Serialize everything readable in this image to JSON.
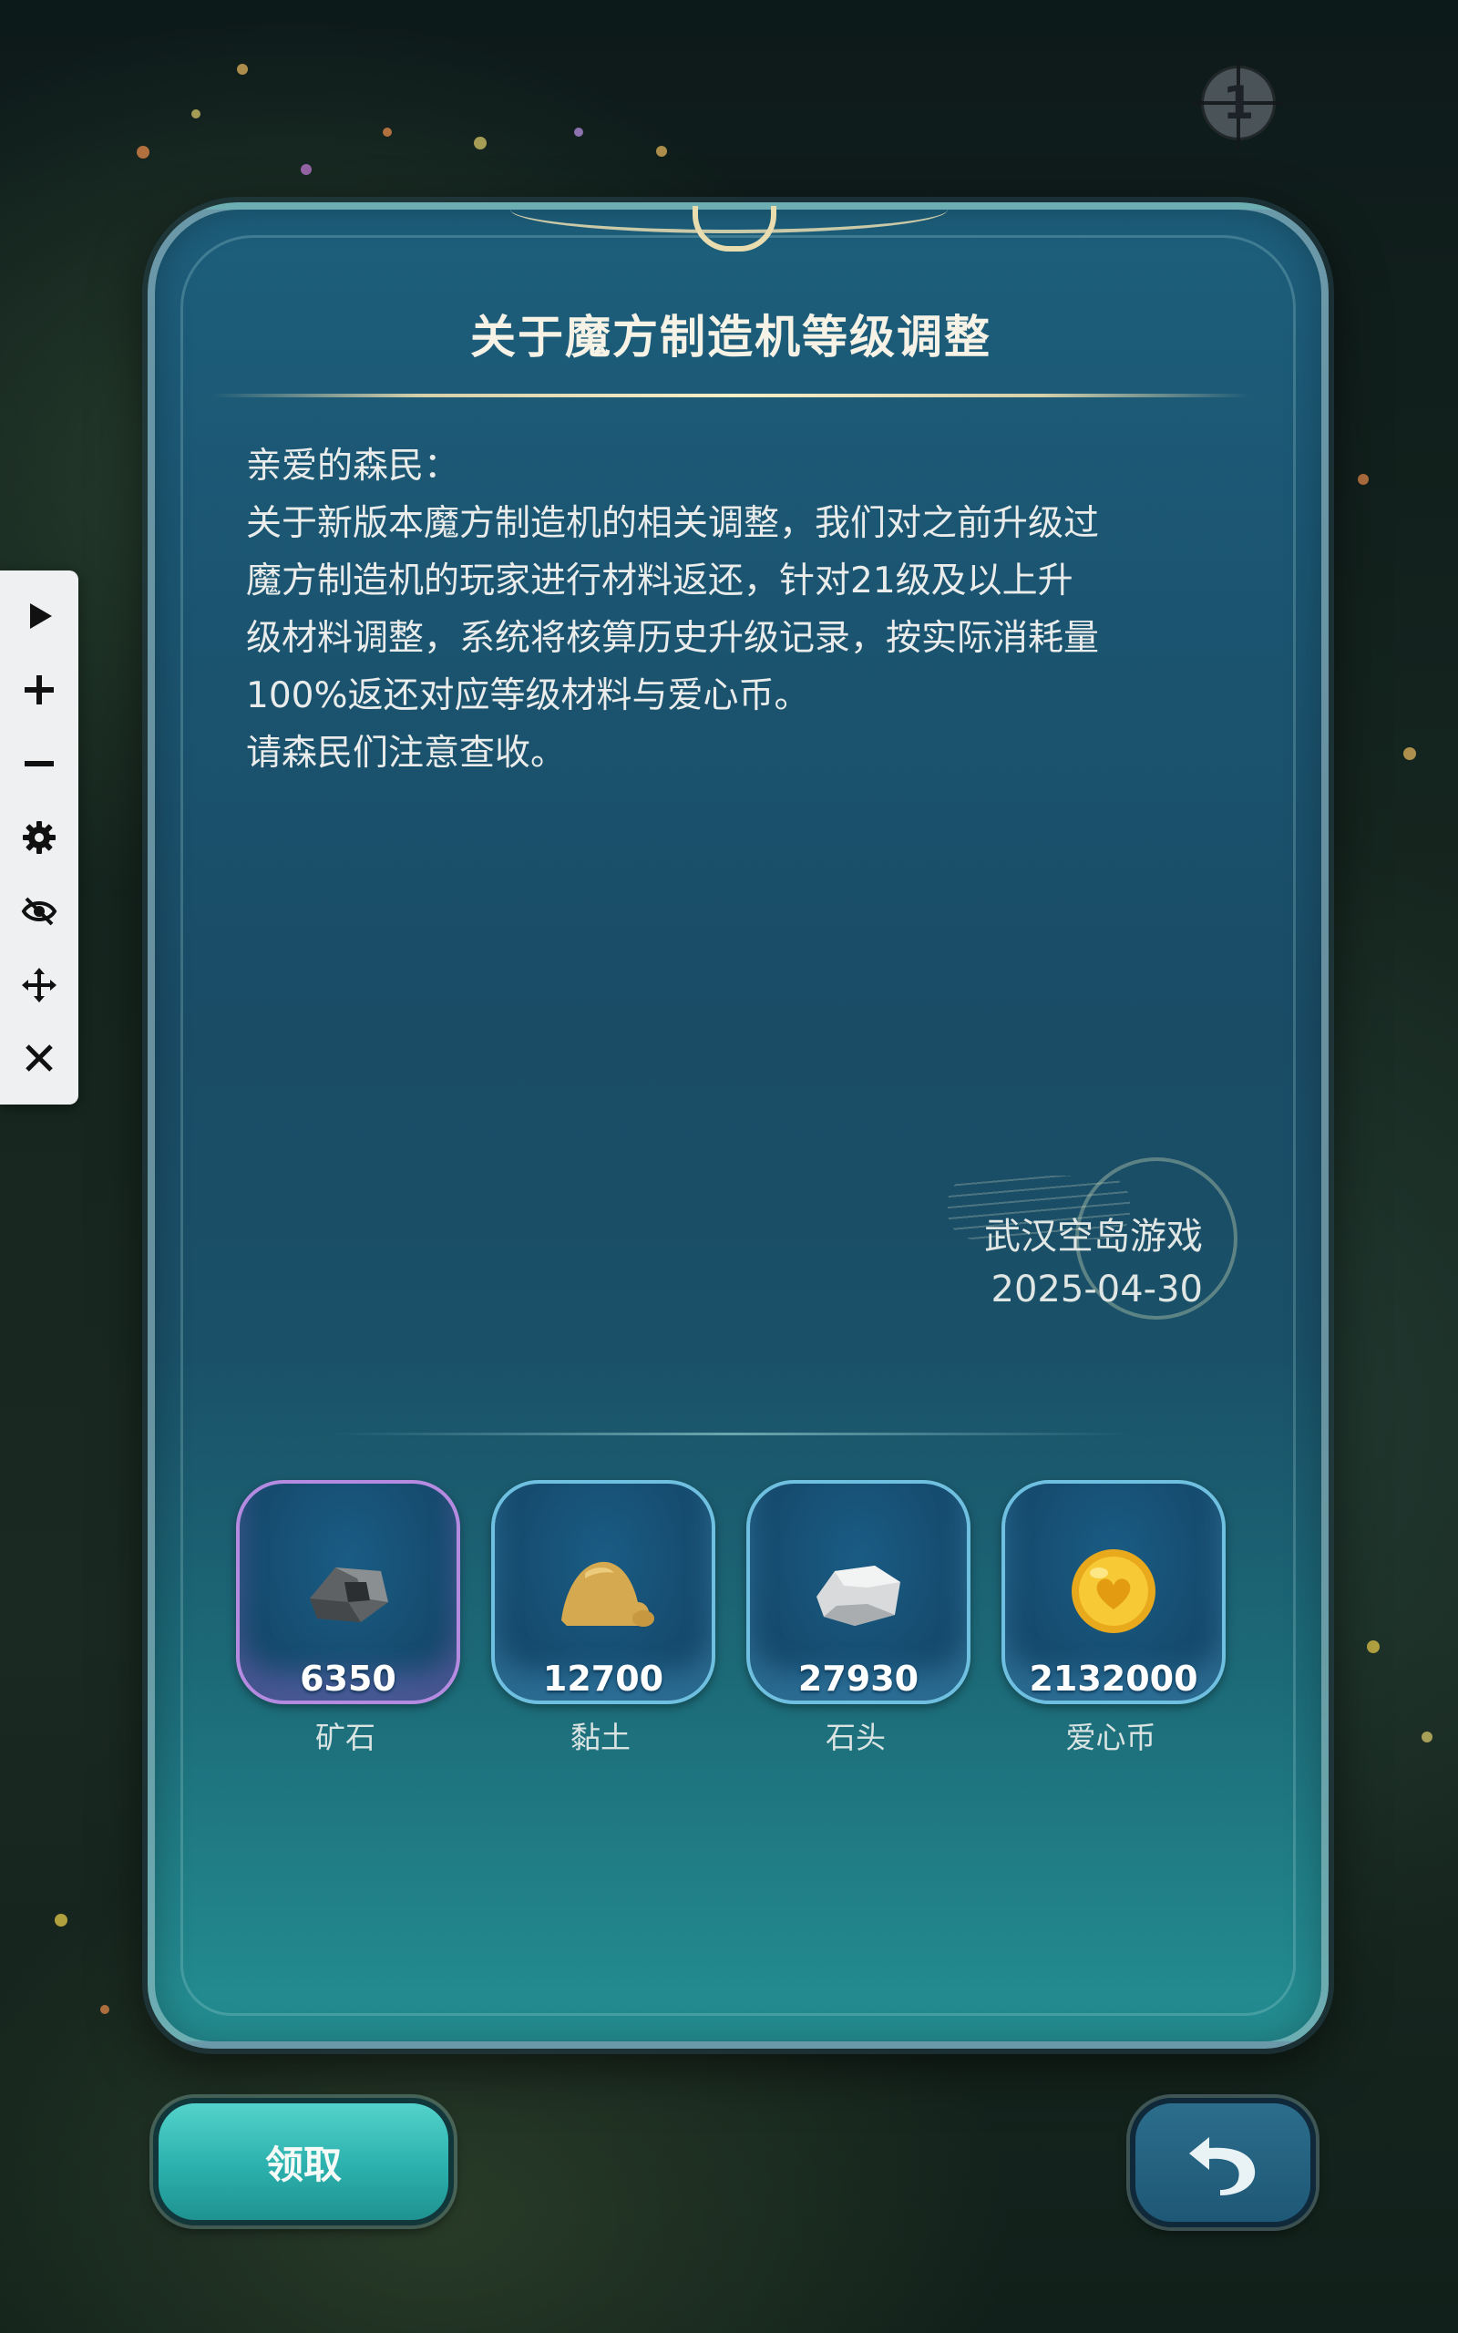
{
  "colors": {
    "panel": "#1b5571",
    "claim_button": "#2bb0ad",
    "back_button": "#1e5876",
    "title_text": "#f6f3e6",
    "tile_border": "#6fc0e0",
    "tile_border_rare": "#b48be0"
  },
  "toolbar": {
    "items": [
      {
        "name": "play",
        "icon": "play-icon"
      },
      {
        "name": "zoom-in",
        "icon": "plus-icon"
      },
      {
        "name": "zoom-out",
        "icon": "minus-icon"
      },
      {
        "name": "settings",
        "icon": "gear-icon"
      },
      {
        "name": "hide",
        "icon": "eye-off-icon"
      },
      {
        "name": "move",
        "icon": "move-icon"
      },
      {
        "name": "close",
        "icon": "close-icon"
      }
    ]
  },
  "badge": {
    "value": "1"
  },
  "mail": {
    "title": "关于魔方制造机等级调整",
    "greeting": "亲爱的森民：",
    "body_lines": [
      "关于新版本魔方制造机的相关调整，我们对之前升级过",
      "魔方制造机的玩家进行材料返还，针对21级及以上升",
      "级材料调整，系统将核算历史升级记录，按实际消耗量",
      "100%返还对应等级材料与爱心币。",
      "请森民们注意查收。"
    ],
    "sender": "武汉空岛游戏",
    "date": "2025-04-30"
  },
  "rewards": [
    {
      "name": "矿石",
      "count": "6350",
      "icon": "ore-icon"
    },
    {
      "name": "黏土",
      "count": "12700",
      "icon": "clay-icon"
    },
    {
      "name": "石头",
      "count": "27930",
      "icon": "stone-icon"
    },
    {
      "name": "爱心币",
      "count": "2132000",
      "icon": "heart-coin-icon"
    }
  ],
  "buttons": {
    "claim_label": "领取",
    "back_icon": "undo-arrow-icon"
  }
}
